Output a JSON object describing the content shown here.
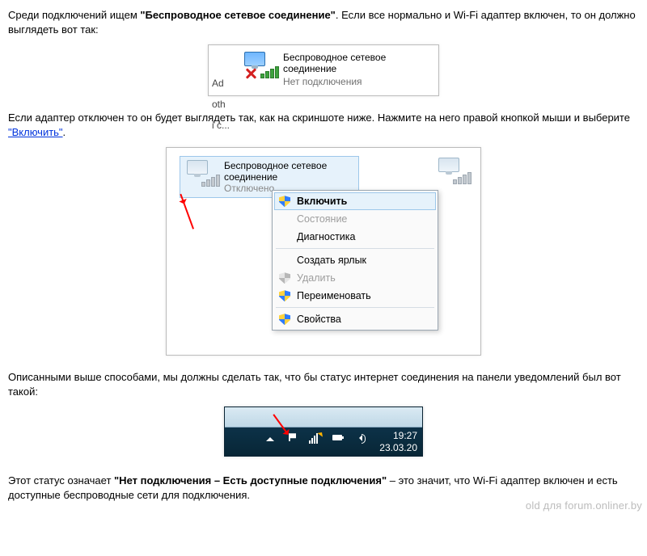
{
  "para1": {
    "pre": "Среди подключений ищем ",
    "bold": "\"Беспроводное сетевое соединение\"",
    "post": ". Если все нормально и Wi-Fi адаптер включен, то он должно выглядеть вот так:"
  },
  "shot1": {
    "title_l1": "Беспроводное сетевое",
    "title_l2": "соединение",
    "status": "Нет подключения",
    "cut1": "Ad",
    "cut2": "oth",
    "cut3": "і с..."
  },
  "para2": {
    "pre": "Если адаптер отключен то он будет выглядеть так, как на скриншоте ниже. Нажмите на него правой кнопкой мыши и выберите ",
    "link": "\"Включить\"",
    "post": "."
  },
  "shot2": {
    "title_l1": "Беспроводное сетевое",
    "title_l2": "соединение",
    "status": "Отключено",
    "menu": {
      "enable": "Включить",
      "status": "Состояние",
      "diag": "Диагностика",
      "create_shortcut": "Создать ярлык",
      "delete": "Удалить",
      "rename": "Переименовать",
      "properties": "Свойства"
    }
  },
  "para3": "Описанными выше способами,  мы должны сделать так, что бы статус интернет соединения на панели уведомлений был вот такой:",
  "shot3": {
    "time": "19:27",
    "date": "23.03.20"
  },
  "para4": {
    "pre": "Этот статус означает ",
    "bold": "\"Нет подключения – Есть доступные подключения\"",
    "post": " – это значит, что Wi-Fi адаптер включен и есть доступные беспроводные сети для подключения."
  },
  "watermark": "old для forum.onliner.by"
}
